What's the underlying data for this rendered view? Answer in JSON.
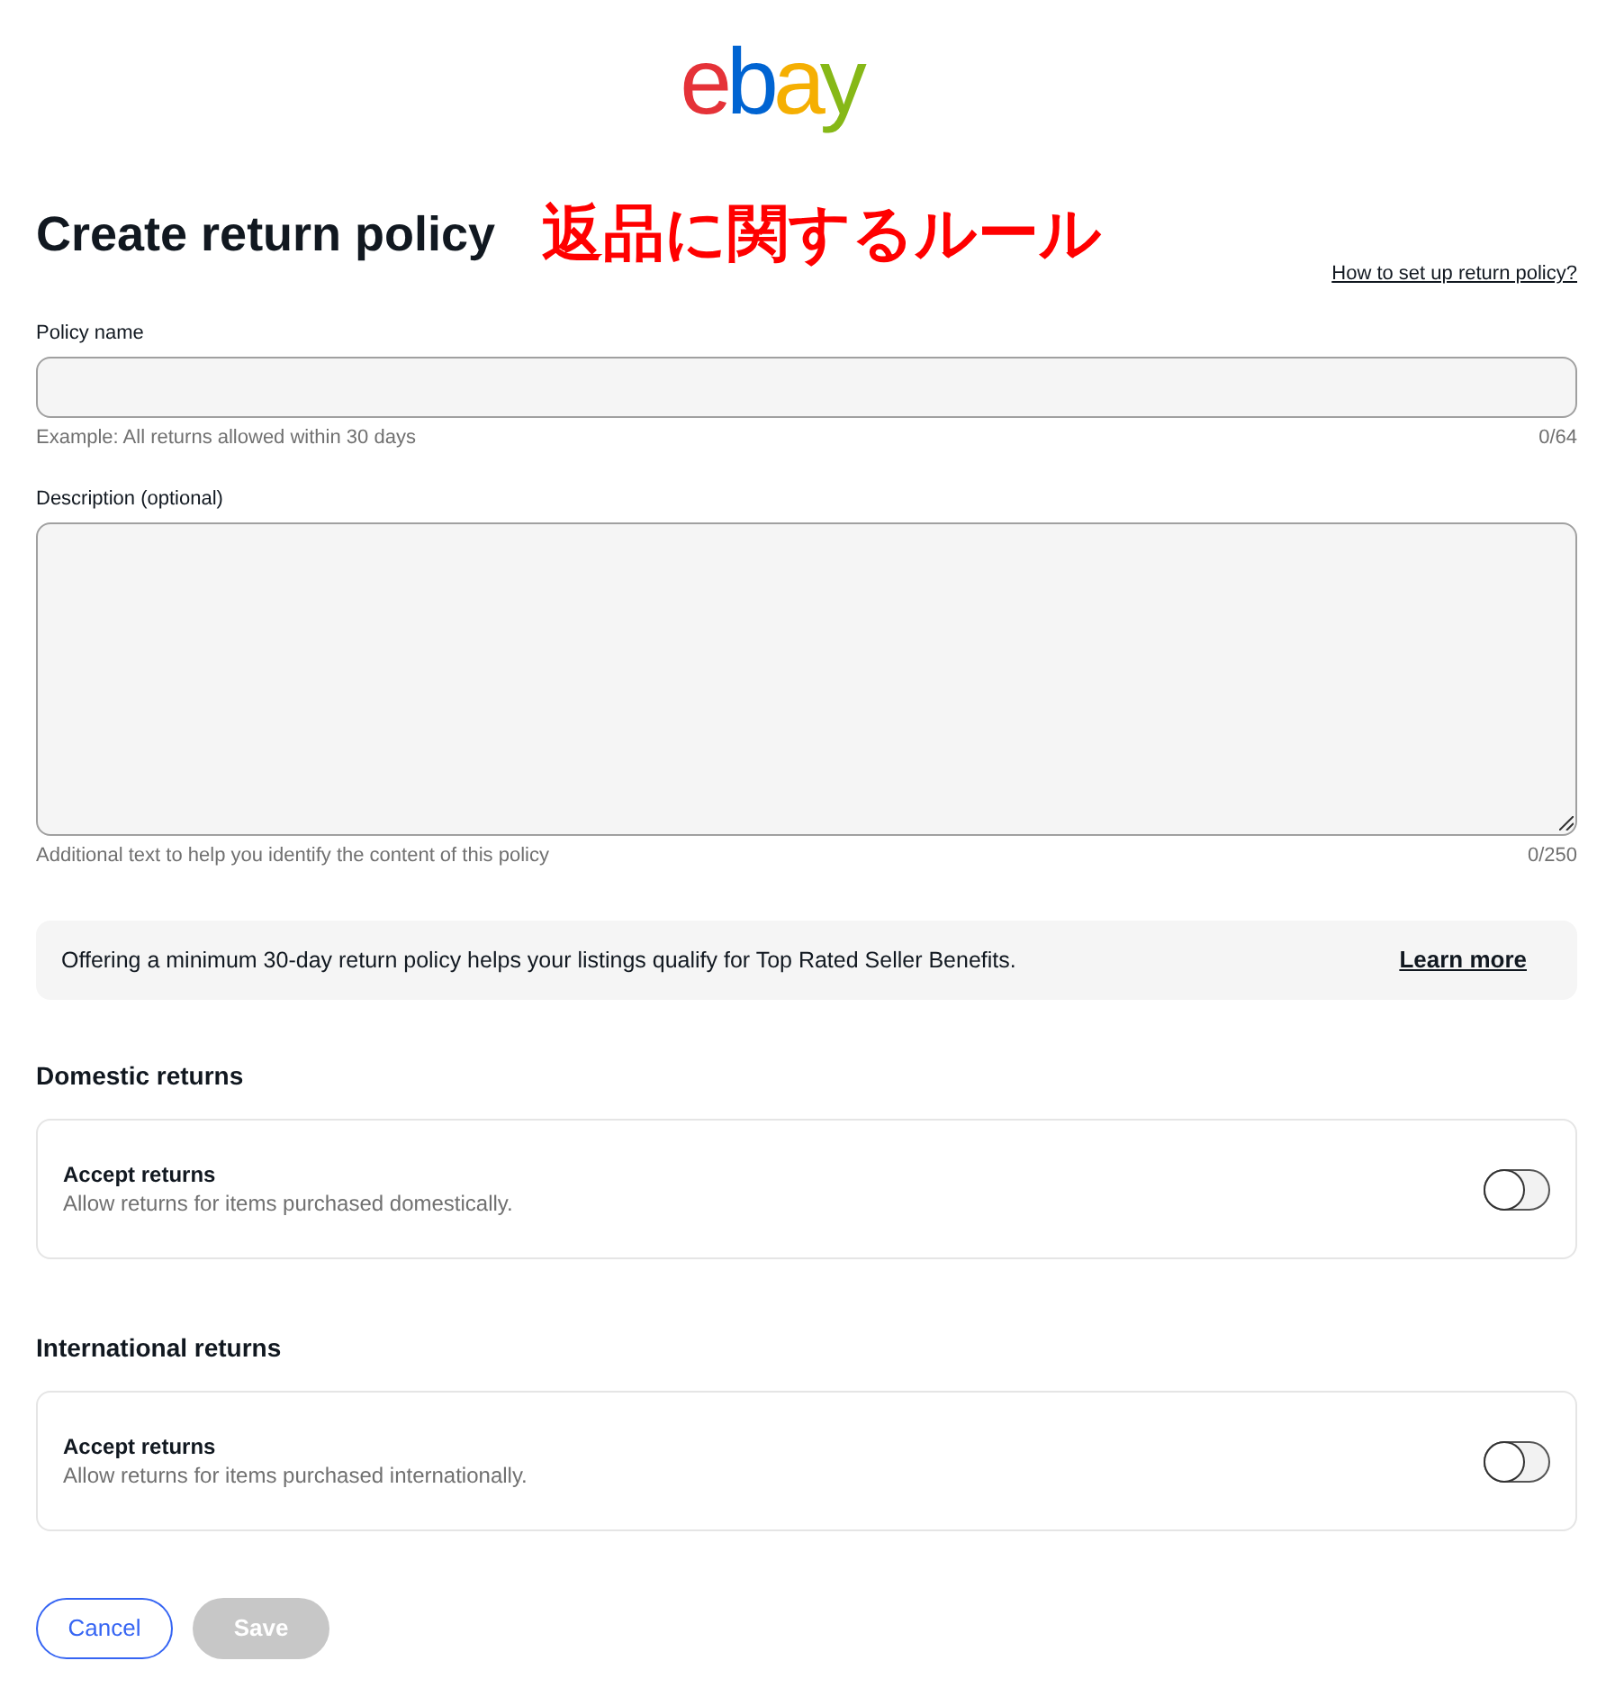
{
  "logo": {
    "letters": [
      {
        "char": "e",
        "color": "#e53238"
      },
      {
        "char": "b",
        "color": "#0064d2"
      },
      {
        "char": "a",
        "color": "#f5af02"
      },
      {
        "char": "y",
        "color": "#86b817"
      }
    ]
  },
  "header": {
    "title": "Create return policy",
    "annotation": "返品に関するルール",
    "help_link": "How to set up return policy?"
  },
  "fields": [
    {
      "kind": "input",
      "label": "Policy name",
      "helper": "Example: All returns allowed within 30 days",
      "counter": "0/64"
    },
    {
      "kind": "textarea",
      "label": "Description (optional)",
      "helper": "Additional text to help you identify the content of this policy",
      "counter": "0/250"
    }
  ],
  "notice": {
    "text": "Offering a minimum 30-day return policy helps your listings qualify for Top Rated Seller Benefits.",
    "link": "Learn more"
  },
  "sections": [
    {
      "heading": "Domestic returns",
      "setting": {
        "label": "Accept returns",
        "description": "Allow returns for items purchased domestically.",
        "on": false
      }
    },
    {
      "heading": "International returns",
      "setting": {
        "label": "Accept returns",
        "description": "Allow returns for items purchased internationally.",
        "on": false
      }
    }
  ],
  "buttons": [
    {
      "label": "Cancel",
      "kind": "secondary",
      "disabled": false
    },
    {
      "label": "Save",
      "kind": "primary",
      "disabled": true
    }
  ]
}
